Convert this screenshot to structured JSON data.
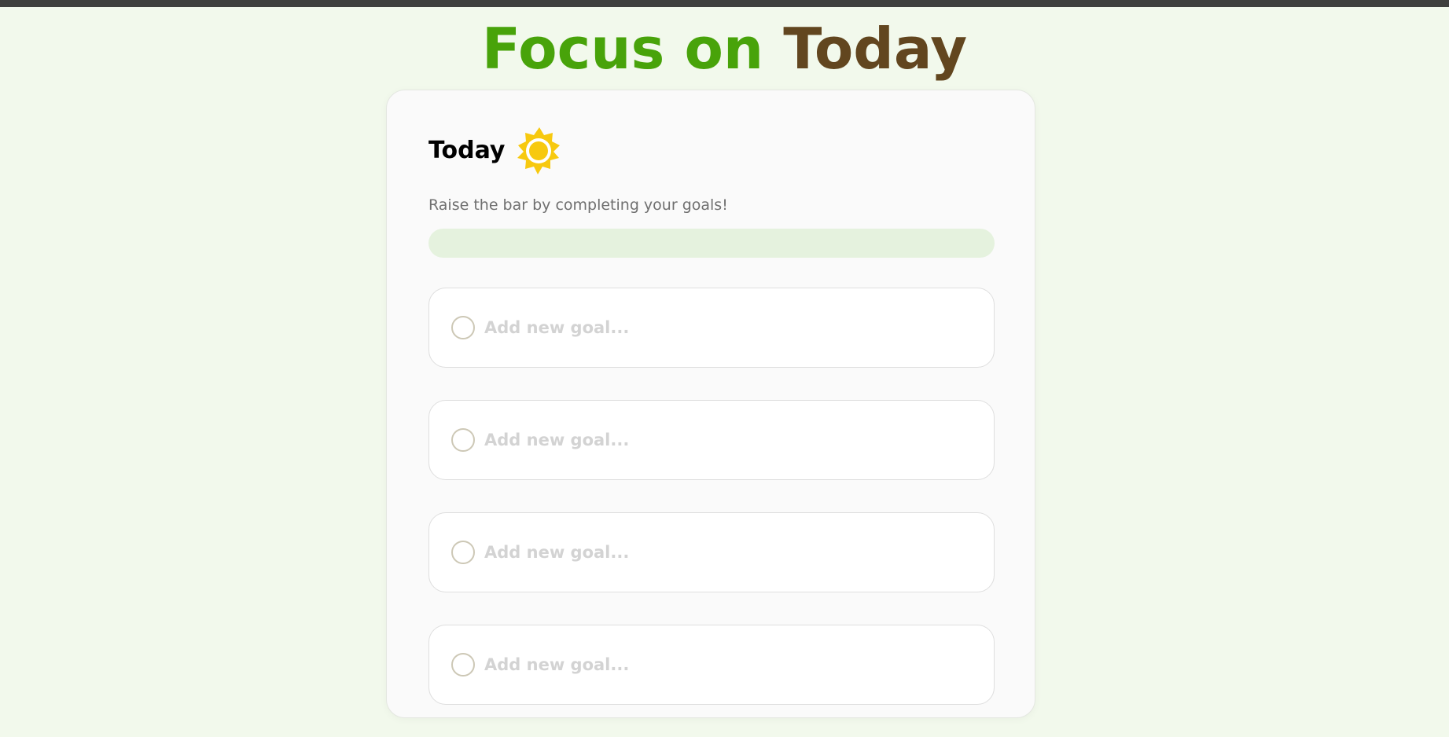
{
  "header": {
    "title_part1": "Focus on",
    "title_part2": "Today"
  },
  "card": {
    "title": "Today",
    "icon": "sun-icon",
    "subtitle": "Raise the bar by completing your goals!",
    "progress": 0
  },
  "goals": [
    {
      "placeholder": "Add new goal...",
      "value": "",
      "completed": false
    },
    {
      "placeholder": "Add new goal...",
      "value": "",
      "completed": false
    },
    {
      "placeholder": "Add new goal...",
      "value": "",
      "completed": false
    },
    {
      "placeholder": "Add new goal...",
      "value": "",
      "completed": false
    }
  ],
  "colors": {
    "background": "#f2f9ec",
    "accent_green": "#48a30a",
    "accent_brown": "#62461f",
    "sun": "#f7c90f",
    "progress_track": "#e5f2de"
  }
}
